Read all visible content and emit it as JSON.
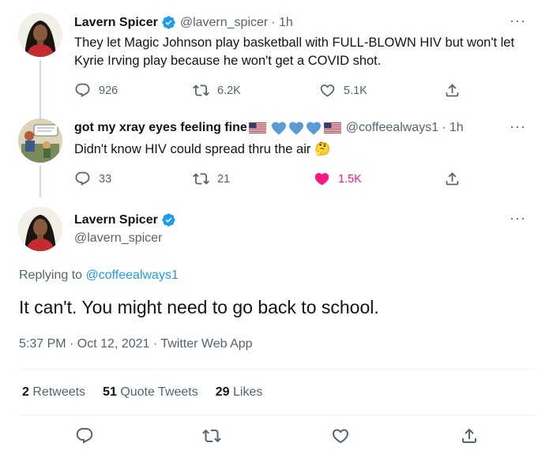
{
  "tweet1": {
    "name": "Lavern Spicer",
    "handle": "@lavern_spicer",
    "time": "· 1h",
    "text": "They let Magic Johnson play basketball with FULL-BLOWN HIV but won't let Kyrie Irving play because he won't get a COVID shot.",
    "replies": "926",
    "retweets": "6.2K",
    "likes": "5.1K"
  },
  "tweet2": {
    "name": "got my xray eyes feeling fine",
    "handle": "@coffeealways1",
    "time": "· 1h",
    "text": "Didn't know HIV could spread thru the air",
    "emoji": "🤔",
    "replies": "33",
    "retweets": "21",
    "likes": "1.5K"
  },
  "main": {
    "name": "Lavern Spicer",
    "handle": "@lavern_spicer",
    "replying_prefix": "Replying to",
    "replying_handle": "@coffeealways1",
    "text": "It can't. You might need to go back to school.",
    "timestamp": "5:37 PM · Oct 12, 2021 · Twitter Web App",
    "retweets_count": "2",
    "retweets_label": "Retweets",
    "quotes_count": "51",
    "quotes_label": "Quote Tweets",
    "likes_count": "29",
    "likes_label": "Likes"
  },
  "colors": {
    "accent": "#1d9bf0",
    "like_active": "#f91880",
    "secondary_text": "#536471",
    "heart_emoji": "#5b9bd5"
  },
  "more_label": "···"
}
